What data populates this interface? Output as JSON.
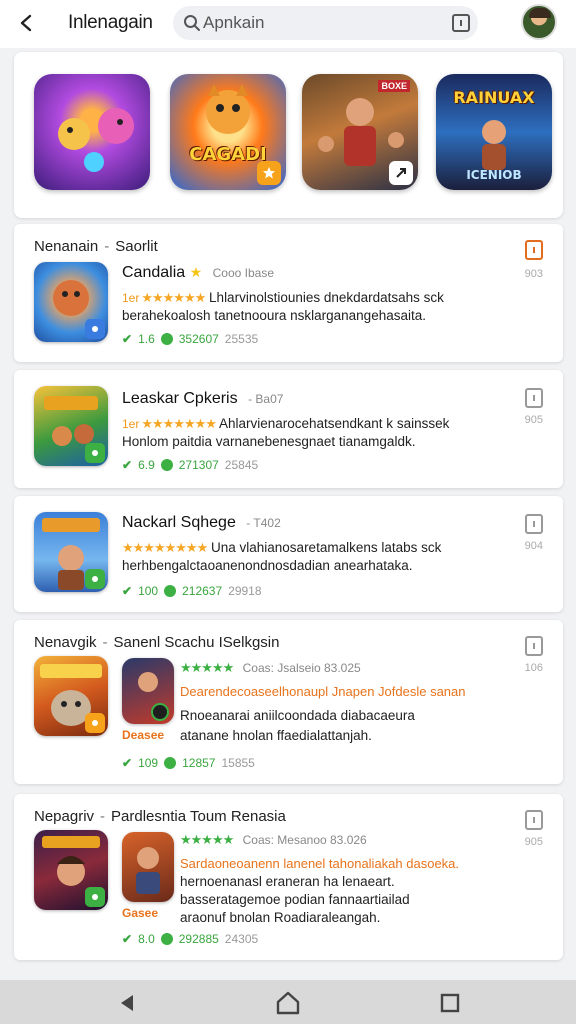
{
  "header": {
    "title": "Inlenagain",
    "search_placeholder": "Apnkain"
  },
  "featured": {
    "tiles": [
      {
        "title": ""
      },
      {
        "title": "CAGADI"
      },
      {
        "title": "BOXE"
      },
      {
        "title": "RAINUAX",
        "subtitle": "ICENIOB"
      }
    ]
  },
  "cards": [
    {
      "heading_left": "Nenanain",
      "heading_sep": "-",
      "heading_right": "Saorlit",
      "name": "Candalia",
      "meta": "Cooo Ibase",
      "prefix": "1er",
      "stars": "★★★★★★",
      "line1": "Lhlarvinolstiounies dnekdardatsahs sck",
      "line2": "berahekoalosh tanetnooura nsklarganangehasaita.",
      "stat1": "1.6",
      "stat2": "352607",
      "stat3": "25535",
      "right_num": "903"
    },
    {
      "heading_left": "",
      "heading_sep": "",
      "heading_right": "",
      "name": "Leaskar Cpkeris",
      "meta": "- Ba07",
      "prefix": "1er",
      "stars": "★★★★★★★",
      "line1": "Ahlarvienarocehatsendkant k sainssek",
      "line2": "Honlom paitdia varnanebenesgnaet tianamgaldk.",
      "stat1": "6.9",
      "stat2": "271307",
      "stat3": "25845",
      "right_num": "905"
    },
    {
      "heading_left": "",
      "heading_sep": "",
      "heading_right": "",
      "name": "Nackarl Sqhege",
      "meta": "- T402",
      "prefix": "",
      "stars": "★★★★★★★★",
      "line1": "Una vlahianosaretamalkens latabs sck",
      "line2": "herhbengalctaoanenondnosdadian anearhataka.",
      "stat1": "100",
      "stat2": "212637",
      "stat3": "29918",
      "right_num": "904"
    },
    {
      "heading_left": "Nenavgik",
      "heading_sep": "-",
      "heading_right": "Sanenl Scachu ISelkgsin",
      "name": "",
      "meta": "Coas: Jsalseio  83.025",
      "prefix": "",
      "stars": "★★★★★",
      "line1": "Dearendecoaseelhonaupl Jnapen Jofdesle sanan",
      "line2": "Rnoeanarai aniilcoondada diabacaeura",
      "line3": "atanane hnolan ffaedialattanjah.",
      "small_label": "Deasee",
      "stat1": "109",
      "stat2": "12857",
      "stat3": "15855",
      "right_num": "106"
    },
    {
      "heading_left": "Nepagriv",
      "heading_sep": "-",
      "heading_right": "Pardlesntia Toum Renasia",
      "name": "",
      "meta": "Coas: Mesanoo  83.026",
      "prefix": "",
      "stars": "★★★★★",
      "line1": "Sardaoneoanenn lanenel tahonaliakah dasoeka.",
      "line2": "hernoenanasl eraneran ha lenaeart.",
      "line3": "basseratagemoe podian fannaartiailad",
      "line4": "araonuf bnolan Roadiaraleangah.",
      "small_label": "Gasee",
      "stat1": "8.0",
      "stat2": "292885",
      "stat3": "24305",
      "right_num": "905"
    }
  ],
  "colors": {
    "accent_green": "#3cb043",
    "accent_orange": "#e8731c",
    "star": "#f5a623"
  }
}
